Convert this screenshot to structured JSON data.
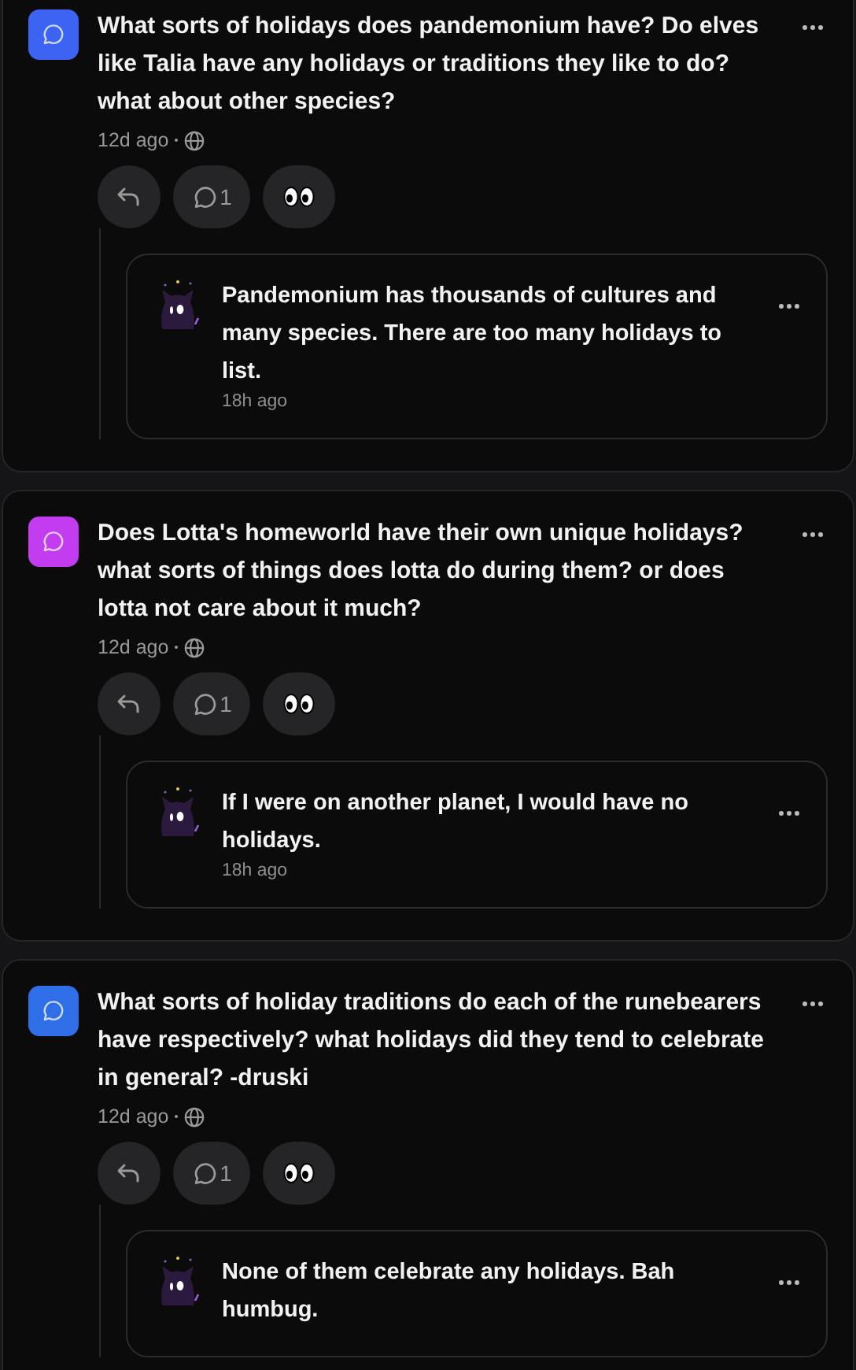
{
  "posts": [
    {
      "color": "#3d63f2",
      "question": "What sorts of holidays does pandemonium have? Do elves like Talia have any holidays or traditions they like to do? what about other species?",
      "time": "12d ago",
      "comment_count": "1",
      "reply": {
        "text": "Pandemonium has thousands of cultures and many species. There are too many holidays to list.",
        "time": "18h ago"
      }
    },
    {
      "color": "#c23cf0",
      "question": "Does Lotta's homeworld have their own unique holidays? what sorts of things does lotta do during them? or does lotta not care about it much?",
      "time": "12d ago",
      "comment_count": "1",
      "reply": {
        "text": "If I were on another planet, I would have no holidays.",
        "time": "18h ago"
      }
    },
    {
      "color": "#2f6ee6",
      "question": "What sorts of holiday traditions do each of the runebearers have respectively? what holidays did they tend to celebrate in general? -druski",
      "time": "12d ago",
      "comment_count": "1",
      "reply": {
        "text": "None of them celebrate any holidays. Bah humbug."
      }
    }
  ]
}
